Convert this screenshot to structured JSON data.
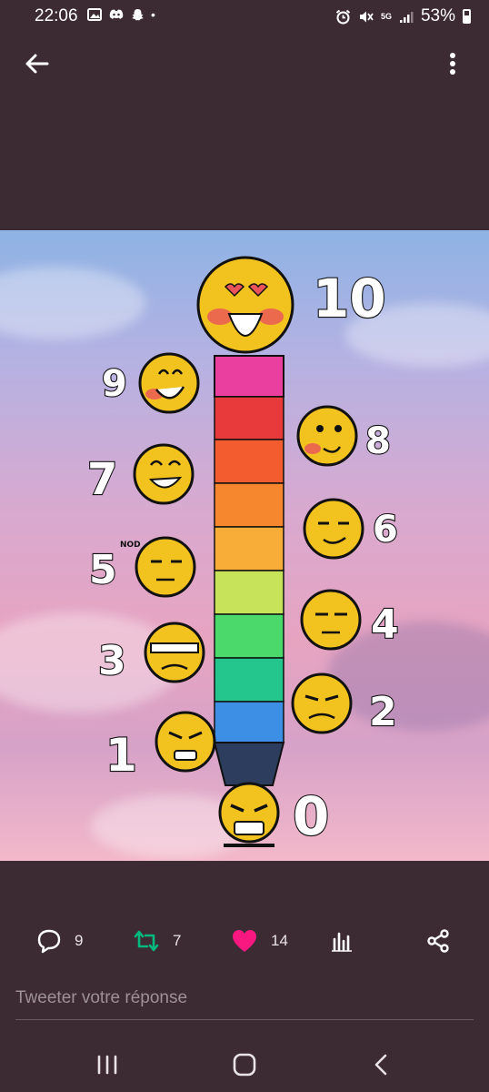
{
  "status_bar": {
    "time": "22:06",
    "battery": "53%",
    "signal_label": "5G"
  },
  "header": {
    "back_icon": "arrow-left-icon",
    "menu_icon": "more-vertical-icon"
  },
  "media": {
    "scale_labels": [
      "10",
      "9",
      "8",
      "7",
      "6",
      "5",
      "4",
      "3",
      "2",
      "1",
      "0"
    ],
    "small_note": "NOD"
  },
  "actions": {
    "reply_count": "9",
    "retweet_count": "7",
    "like_count": "14",
    "retweet_color": "#00ba7c",
    "like_color": "#f91880"
  },
  "reply_box": {
    "placeholder": "Tweeter votre réponse"
  },
  "colors": {
    "background": "#3c2b33",
    "icon": "#ffffff"
  }
}
